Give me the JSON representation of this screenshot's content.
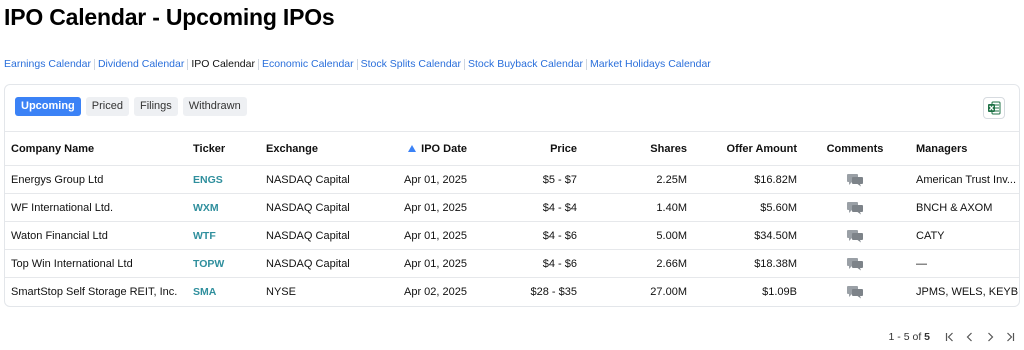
{
  "page": {
    "title": "IPO Calendar - Upcoming IPOs"
  },
  "nav": [
    {
      "label": "Earnings Calendar",
      "current": false
    },
    {
      "label": "Dividend Calendar",
      "current": false
    },
    {
      "label": "IPO Calendar",
      "current": true
    },
    {
      "label": "Economic Calendar",
      "current": false
    },
    {
      "label": "Stock Splits Calendar",
      "current": false
    },
    {
      "label": "Stock Buyback Calendar",
      "current": false
    },
    {
      "label": "Market Holidays Calendar",
      "current": false
    }
  ],
  "tabs": [
    {
      "label": "Upcoming",
      "active": true
    },
    {
      "label": "Priced",
      "active": false
    },
    {
      "label": "Filings",
      "active": false
    },
    {
      "label": "Withdrawn",
      "active": false
    }
  ],
  "export_icon": "excel-icon",
  "table": {
    "headers": {
      "company": "Company Name",
      "ticker": "Ticker",
      "exchange": "Exchange",
      "date": "IPO Date",
      "price": "Price",
      "shares": "Shares",
      "offer": "Offer Amount",
      "comments": "Comments",
      "managers": "Managers"
    },
    "sort": {
      "column": "IPO Date",
      "direction": "ascending"
    },
    "rows": [
      {
        "company": "Energys Group Ltd",
        "ticker": "ENGS",
        "exchange": "NASDAQ Capital",
        "date": "Apr 01, 2025",
        "price": "$5 - $7",
        "shares": "2.25M",
        "offer": "$16.82M",
        "managers": "American Trust Inv..."
      },
      {
        "company": "WF International Ltd.",
        "ticker": "WXM",
        "exchange": "NASDAQ Capital",
        "date": "Apr 01, 2025",
        "price": "$4 - $4",
        "shares": "1.40M",
        "offer": "$5.60M",
        "managers": "BNCH & AXOM"
      },
      {
        "company": "Waton Financial Ltd",
        "ticker": "WTF",
        "exchange": "NASDAQ Capital",
        "date": "Apr 01, 2025",
        "price": "$4 - $6",
        "shares": "5.00M",
        "offer": "$34.50M",
        "managers": "CATY"
      },
      {
        "company": "Top Win International Ltd",
        "ticker": "TOPW",
        "exchange": "NASDAQ Capital",
        "date": "Apr 01, 2025",
        "price": "$4 - $6",
        "shares": "2.66M",
        "offer": "$18.38M",
        "managers": "—"
      },
      {
        "company": "SmartStop Self Storage REIT, Inc.",
        "ticker": "SMA",
        "exchange": "NYSE",
        "date": "Apr 02, 2025",
        "price": "$28 - $35",
        "shares": "27.00M",
        "offer": "$1.09B",
        "managers": "JPMS, WELS, KEYB..."
      }
    ]
  },
  "pagination": {
    "range_label": "1 - 5 of",
    "total": "5"
  },
  "colors": {
    "accent": "#3b82f6",
    "link": "#2a6fdb",
    "ticker": "#2f8f9d",
    "excel": "#1e7145"
  }
}
